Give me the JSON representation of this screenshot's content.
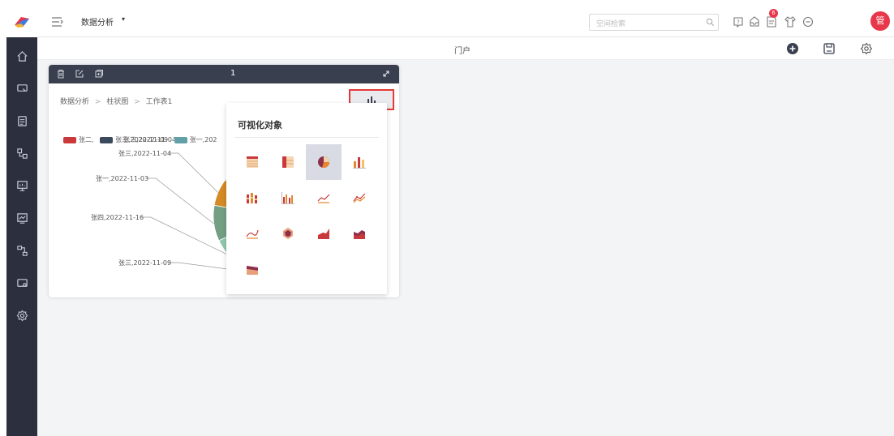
{
  "header": {
    "app_title": "数据分析",
    "app_caret": "▾",
    "search_placeholder": "空间检索",
    "notification_count": "6",
    "avatar_text": "管"
  },
  "subbar": {
    "title": "门户"
  },
  "card": {
    "number": "1",
    "breadcrumb": [
      "数据分析",
      ">",
      "柱状图",
      ">",
      "工作表1"
    ]
  },
  "chart_data": {
    "type": "pie",
    "legend": [
      {
        "name": "张二,",
        "color": "#c9383a"
      },
      {
        "name": "张三,2022-11-09",
        "color": "#3a4a5c"
      },
      {
        "name": "张一,202",
        "color": "#61a0a8"
      }
    ],
    "overlay_text": "张三,2022-11-04",
    "slices": [
      {
        "label": "张三,2022-11-04",
        "color": "#d48a25"
      },
      {
        "label": "张一,2022-11-03",
        "color": "#749f83"
      },
      {
        "label": "张四,2022-11-16",
        "color": "#91c7ae"
      },
      {
        "label": "张三,2022-11-09",
        "color": "#d7835b"
      },
      {
        "label": "",
        "color": "#61a0a8"
      },
      {
        "label": "",
        "color": "#bda29a"
      }
    ]
  },
  "vis_panel": {
    "title": "可视化对象",
    "icons": [
      "table-icon",
      "crosstab-icon",
      "pie-chart-icon",
      "bar-chart-icon",
      "stacked-bar-icon",
      "grouped-bar-icon",
      "line-chart-icon",
      "multi-line-icon",
      "smooth-line-icon",
      "radar-icon",
      "area-chart-icon",
      "stacked-area-icon",
      "stream-area-icon"
    ],
    "selected": "pie-chart-icon"
  }
}
